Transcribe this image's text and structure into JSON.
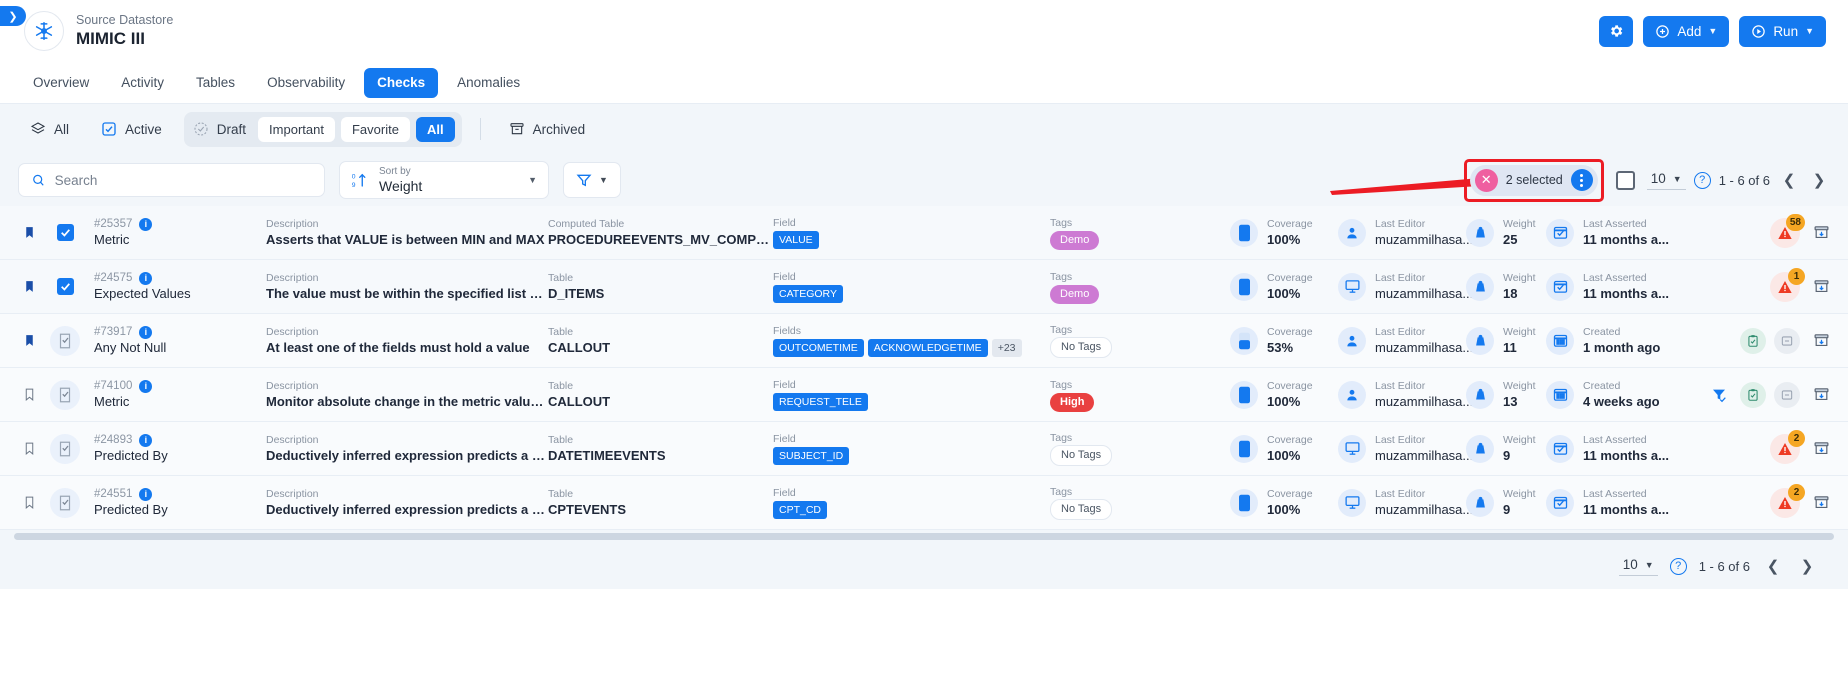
{
  "header": {
    "datastore_label": "Source Datastore",
    "datastore_name": "MIMIC III",
    "settings_icon": "gear-icon",
    "add_label": "Add",
    "run_label": "Run"
  },
  "tabs": [
    {
      "label": "Overview",
      "active": false
    },
    {
      "label": "Activity",
      "active": false
    },
    {
      "label": "Tables",
      "active": false
    },
    {
      "label": "Observability",
      "active": false
    },
    {
      "label": "Checks",
      "active": true
    },
    {
      "label": "Anomalies",
      "active": false
    }
  ],
  "filterbar": {
    "all_label": "All",
    "active_label": "Active",
    "draft_label": "Draft",
    "segments": [
      {
        "label": "Important",
        "active": false
      },
      {
        "label": "Favorite",
        "active": false
      },
      {
        "label": "All",
        "active": true
      }
    ],
    "archived_label": "Archived"
  },
  "toolbar": {
    "search_placeholder": "Search",
    "search_value": "",
    "sort_label": "Sort by",
    "sort_value": "Weight",
    "selected_text": "2 selected",
    "page_size": "10",
    "range_text": "1 - 6 of 6"
  },
  "footer": {
    "page_size": "10",
    "range_text": "1 - 6 of 6"
  },
  "colors": {
    "accent": "#1479ef",
    "highlight_box": "#ec1c24",
    "pill_x": "#ef5fa0",
    "tag_demo": "#cd7ad3",
    "tag_high": "#e94040",
    "warn_badge": "#f5a623",
    "warn_triangle": "#ee3b24"
  },
  "labels": {
    "description": "Description",
    "table": "Table",
    "computed_table": "Computed Table",
    "field": "Field",
    "fields": "Fields",
    "tags": "Tags",
    "coverage": "Coverage",
    "last_editor": "Last Editor",
    "weight": "Weight",
    "last_asserted": "Last Asserted",
    "created": "Created"
  },
  "rows": [
    {
      "id": "#25357",
      "name": "Metric",
      "bookmarked": true,
      "checked": true,
      "desc_label": "Description",
      "description": "Asserts that VALUE is between MIN and MAX",
      "table_label": "Computed Table",
      "table": "PROCEDUREEVENTS_MV_COMPUTED",
      "field_label": "Field",
      "fields": [
        "VALUE"
      ],
      "more_fields": "",
      "tags_label": "Tags",
      "tags": [
        {
          "text": "Demo",
          "style": "demo"
        }
      ],
      "coverage": "100%",
      "coverage_fill": 100,
      "editor": "muzammilhasa...",
      "editor_icon": "person-icon",
      "weight": "25",
      "date_label": "Last Asserted",
      "date_value": "11 months a...",
      "date_icon": "calendar-check-icon",
      "warn_count": "58",
      "show_warn": true,
      "show_filter_icon": false,
      "show_round_actions": false
    },
    {
      "id": "#24575",
      "name": "Expected Values",
      "bookmarked": true,
      "checked": true,
      "desc_label": "Description",
      "description": "The value must be within the specified list of v...",
      "table_label": "Table",
      "table": "D_ITEMS",
      "field_label": "Field",
      "fields": [
        "CATEGORY"
      ],
      "more_fields": "",
      "tags_label": "Tags",
      "tags": [
        {
          "text": "Demo",
          "style": "demo"
        }
      ],
      "coverage": "100%",
      "coverage_fill": 100,
      "editor": "muzammilhasa...",
      "editor_icon": "monitor-icon",
      "weight": "18",
      "date_label": "Last Asserted",
      "date_value": "11 months a...",
      "date_icon": "calendar-check-icon",
      "warn_count": "1",
      "show_warn": true,
      "show_filter_icon": false,
      "show_round_actions": false
    },
    {
      "id": "#73917",
      "name": "Any Not Null",
      "bookmarked": true,
      "checked": false,
      "desc_label": "Description",
      "description": "At least one of the fields must hold a value",
      "table_label": "Table",
      "table": "CALLOUT",
      "field_label": "Fields",
      "fields": [
        "OUTCOMETIME",
        "ACKNOWLEDGETIME"
      ],
      "more_fields": "+23",
      "tags_label": "Tags",
      "tags": [
        {
          "text": "No Tags",
          "style": "none"
        }
      ],
      "coverage": "53%",
      "coverage_fill": 53,
      "editor": "muzammilhasa...",
      "editor_icon": "person-icon",
      "weight": "11",
      "date_label": "Created",
      "date_value": "1 month ago",
      "date_icon": "calendar-icon",
      "warn_count": "",
      "show_warn": false,
      "show_filter_icon": false,
      "show_round_actions": true
    },
    {
      "id": "#74100",
      "name": "Metric",
      "bookmarked": false,
      "checked": false,
      "desc_label": "Description",
      "description": "Monitor absolute change in the metric value w...",
      "table_label": "Table",
      "table": "CALLOUT",
      "field_label": "Field",
      "fields": [
        "REQUEST_TELE"
      ],
      "more_fields": "",
      "tags_label": "Tags",
      "tags": [
        {
          "text": "High",
          "style": "high"
        }
      ],
      "coverage": "100%",
      "coverage_fill": 100,
      "editor": "muzammilhasa...",
      "editor_icon": "person-icon",
      "weight": "13",
      "date_label": "Created",
      "date_value": "4 weeks ago",
      "date_icon": "calendar-icon",
      "warn_count": "",
      "show_warn": false,
      "show_filter_icon": true,
      "show_round_actions": true
    },
    {
      "id": "#24893",
      "name": "Predicted By",
      "bookmarked": false,
      "checked": false,
      "desc_label": "Description",
      "description": "Deductively inferred expression predicts a val...",
      "table_label": "Table",
      "table": "DATETIMEEVENTS",
      "field_label": "Field",
      "fields": [
        "SUBJECT_ID"
      ],
      "more_fields": "",
      "tags_label": "Tags",
      "tags": [
        {
          "text": "No Tags",
          "style": "none"
        }
      ],
      "coverage": "100%",
      "coverage_fill": 100,
      "editor": "muzammilhasa...",
      "editor_icon": "monitor-icon",
      "weight": "9",
      "date_label": "Last Asserted",
      "date_value": "11 months a...",
      "date_icon": "calendar-check-icon",
      "warn_count": "2",
      "show_warn": true,
      "show_filter_icon": false,
      "show_round_actions": false
    },
    {
      "id": "#24551",
      "name": "Predicted By",
      "bookmarked": false,
      "checked": false,
      "desc_label": "Description",
      "description": "Deductively inferred expression predicts a val...",
      "table_label": "Table",
      "table": "CPTEVENTS",
      "field_label": "Field",
      "fields": [
        "CPT_CD"
      ],
      "more_fields": "",
      "tags_label": "Tags",
      "tags": [
        {
          "text": "No Tags",
          "style": "none"
        }
      ],
      "coverage": "100%",
      "coverage_fill": 100,
      "editor": "muzammilhasa...",
      "editor_icon": "monitor-icon",
      "weight": "9",
      "date_label": "Last Asserted",
      "date_value": "11 months a...",
      "date_icon": "calendar-check-icon",
      "warn_count": "2",
      "show_warn": true,
      "show_filter_icon": false,
      "show_round_actions": false
    }
  ]
}
